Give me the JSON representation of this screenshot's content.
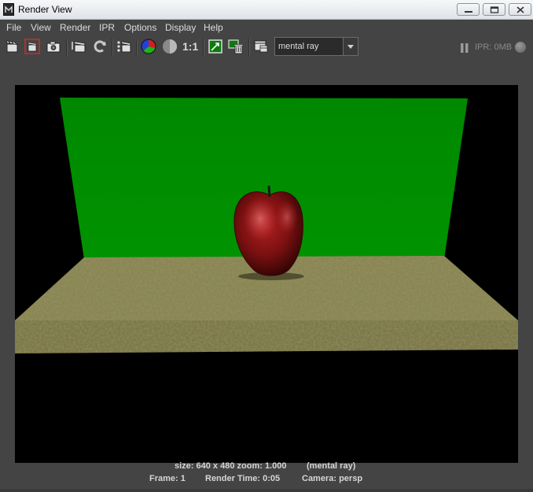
{
  "window": {
    "title": "Render View"
  },
  "menu": [
    "File",
    "View",
    "Render",
    "IPR",
    "Options",
    "Display",
    "Help"
  ],
  "toolbar": {
    "icons": [
      "redo-render-icon",
      "render-region-icon",
      "snapshot-icon",
      "ipr-render-icon",
      "refresh-icon",
      "render-sequence-icon",
      "rgb-channels-icon",
      "alpha-channel-icon",
      "real-size-icon",
      "keep-image-icon",
      "remove-image-icon",
      "render-settings-icon"
    ],
    "ratio_label": "1:1",
    "renderer": "mental ray",
    "ipr_memory": "IPR: 0MB"
  },
  "status": {
    "size": "size: 640 x 480 zoom: 1.000",
    "renderer": "(mental ray)",
    "frame": "Frame: 1",
    "render_time": "Render Time: 0:05",
    "camera": "Camera: persp"
  },
  "colors": {
    "backdrop": "#008c00",
    "floor": "#8a8652",
    "apple": "#8b1414",
    "background": "#000000"
  }
}
